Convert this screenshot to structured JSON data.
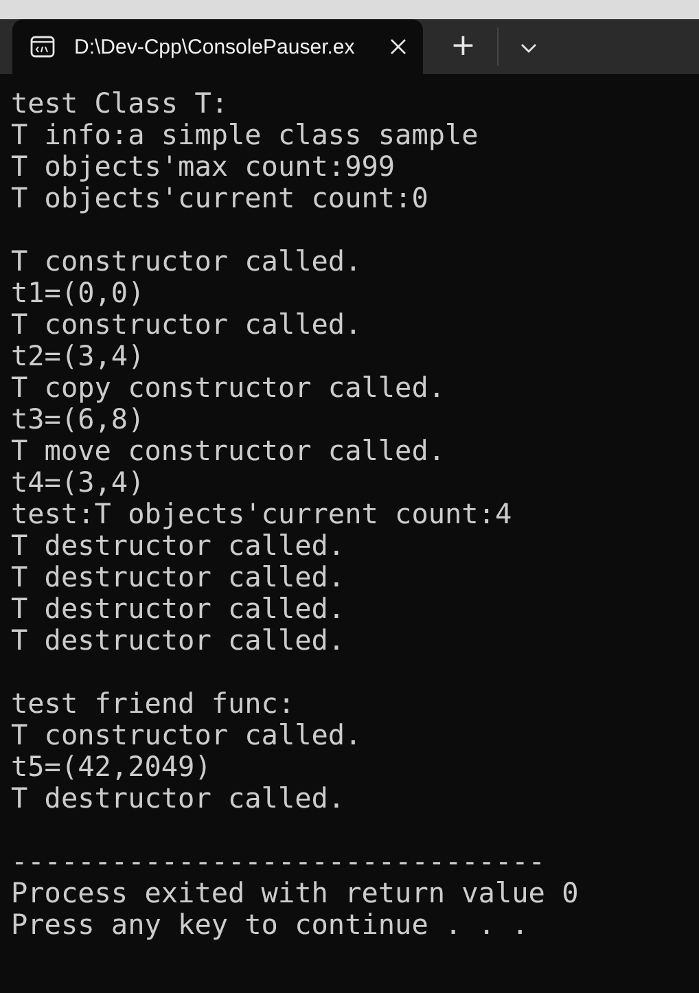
{
  "tabs": [
    {
      "title": "D:\\Dev-Cpp\\ConsolePauser.ex",
      "selected": true
    }
  ],
  "new_tab_symbol": "+",
  "console": {
    "blocks": [
      [
        "test Class T:",
        "T info:a simple class sample",
        "T objects'max count:999",
        "T objects'current count:0"
      ],
      [
        "T constructor called.",
        "t1=(0,0)",
        "T constructor called.",
        "t2=(3,4)",
        "T copy constructor called.",
        "t3=(6,8)",
        "T move constructor called.",
        "t4=(3,4)",
        "test:T objects'current count:4",
        "T destructor called.",
        "T destructor called.",
        "T destructor called.",
        "T destructor called."
      ],
      [
        "test friend func:",
        "T constructor called.",
        "t5=(42,2049)",
        "T destructor called."
      ],
      [
        "--------------------------------",
        "Process exited with return value 0",
        "Press any key to continue . . ."
      ]
    ]
  }
}
